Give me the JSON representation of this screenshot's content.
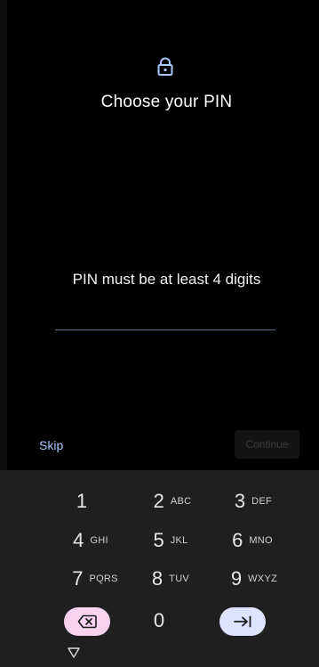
{
  "screen": {
    "title": "Choose your PIN",
    "hint": "PIN must be at least 4 digits",
    "pin_value": ""
  },
  "actions": {
    "skip_label": "Skip",
    "continue_label": "Continue"
  },
  "keypad": {
    "keys": [
      {
        "digit": "1",
        "letters": ""
      },
      {
        "digit": "2",
        "letters": "ABC"
      },
      {
        "digit": "3",
        "letters": "DEF"
      },
      {
        "digit": "4",
        "letters": "GHI"
      },
      {
        "digit": "5",
        "letters": "JKL"
      },
      {
        "digit": "6",
        "letters": "MNO"
      },
      {
        "digit": "7",
        "letters": "PQRS"
      },
      {
        "digit": "8",
        "letters": "TUV"
      },
      {
        "digit": "9",
        "letters": "WXYZ"
      }
    ],
    "zero": "0",
    "icons": {
      "backspace": "backspace-icon",
      "enter": "tab-enter-icon",
      "nav_back": "nav-back-icon"
    }
  },
  "colors": {
    "accent": "#a8c7fa",
    "backspace_key": "#f7d3ef",
    "enter_key": "#dfe3ff",
    "keyboard_bg": "#1f1f1f"
  }
}
